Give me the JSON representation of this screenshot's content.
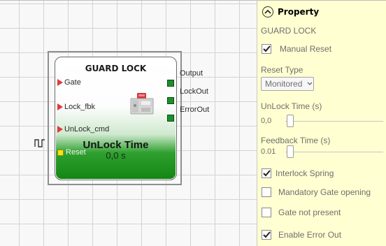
{
  "block": {
    "title": "GUARD LOCK",
    "inputs": [
      "Gate",
      "Lock_fbk",
      "UnLock_cmd"
    ],
    "reset_label": "Reset",
    "outputs": [
      "Output",
      "LockOut",
      "ErrorOut"
    ],
    "param_name": "UnLock Time",
    "param_value": "0,0 s"
  },
  "panel": {
    "title": "Property",
    "component_name": "GUARD LOCK",
    "manual_reset": {
      "label": "Manual Reset",
      "checked": true
    },
    "reset_type": {
      "label": "Reset Type",
      "value": "Monitored"
    },
    "unlock_time": {
      "label": "UnLock Time (s)",
      "value": "0,0"
    },
    "feedback_time": {
      "label": "Feedback Time (s)",
      "value": "0.01"
    },
    "interlock_spring": {
      "label": "Interlock Spring",
      "checked": true
    },
    "mandatory_gate_opening": {
      "label": "Mandatory Gate opening",
      "checked": false
    },
    "gate_not_present": {
      "label": "Gate not present",
      "checked": false
    },
    "enable_error_out": {
      "label": "Enable Error Out",
      "checked": true
    }
  },
  "colors": {
    "panel_background": "#ffffd1",
    "input_port": "#e3383a",
    "output_port": "#1b8f2a",
    "reset_port": "#f2e51a",
    "block_bottom": "#128612"
  },
  "icons": {
    "collapse": "chevron-up-circle-icon",
    "checkmark": "checkmark-icon",
    "dropdown": "chevron-down-icon",
    "pulse": "pulse-icon",
    "device": "guard-lock-device-icon"
  }
}
